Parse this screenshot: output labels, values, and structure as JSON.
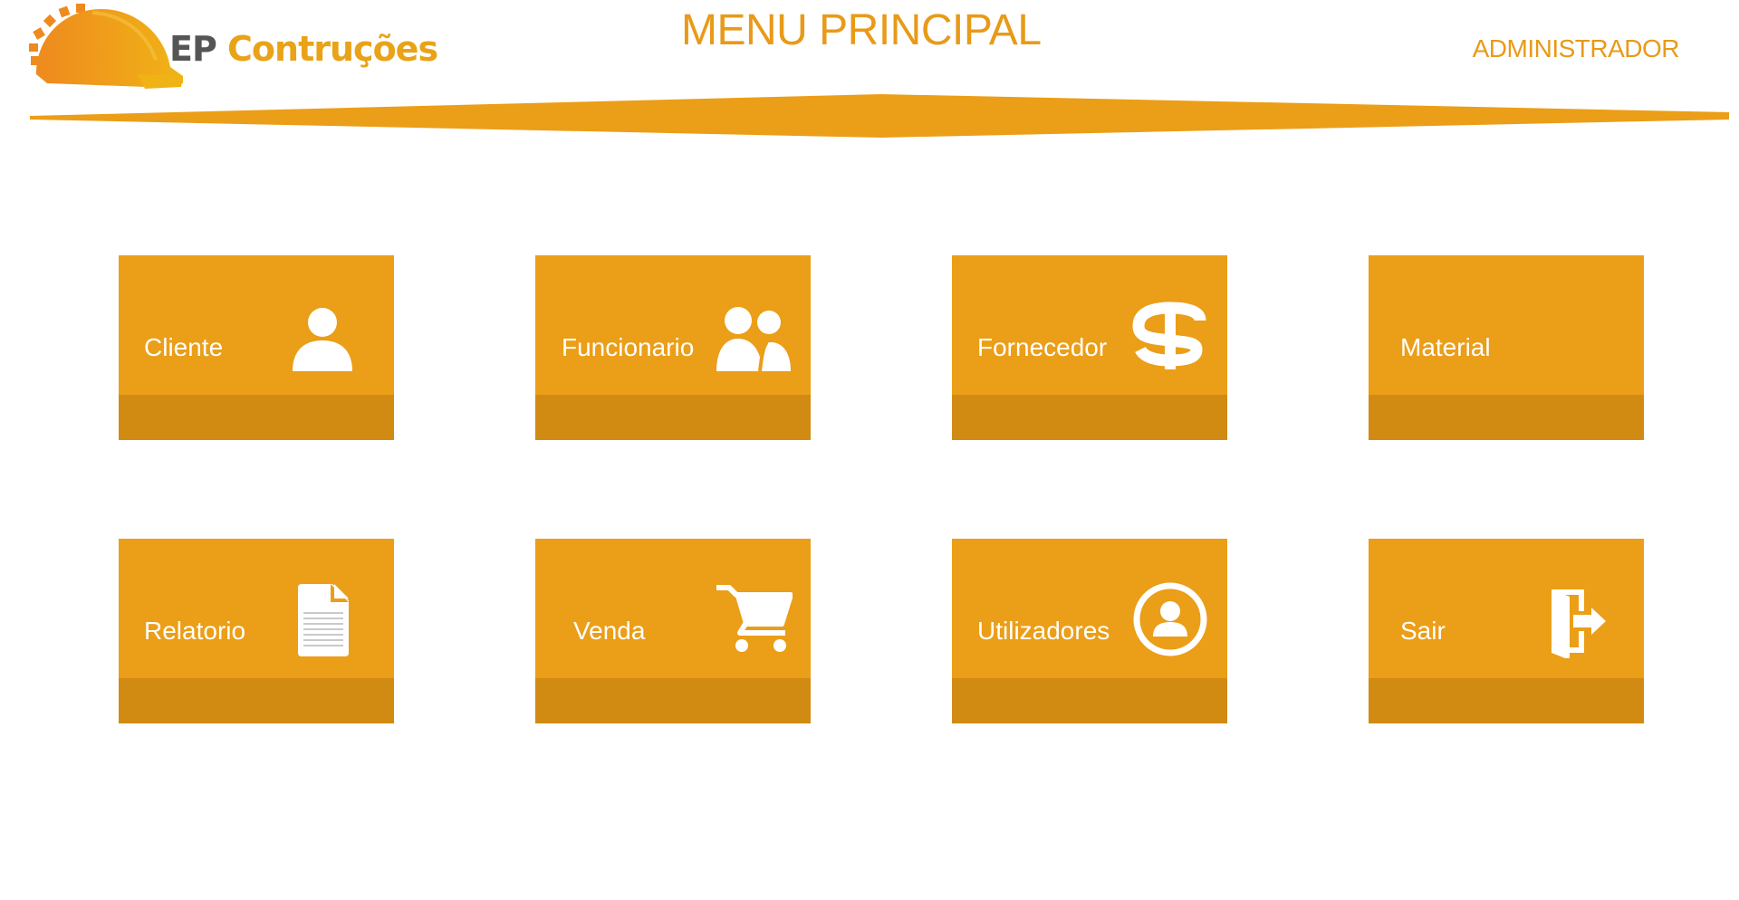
{
  "header": {
    "logo_ep": "EP",
    "logo_name": "Contruções",
    "title": "MENU PRINCIPAL",
    "user_role": "ADMINISTRADOR"
  },
  "colors": {
    "accent": "#eb9e17",
    "accent_dark": "#d18b13",
    "title": "#e89a18",
    "logo_grey": "#555555"
  },
  "menu": {
    "items": [
      {
        "label": "Cliente",
        "icon": "person-icon"
      },
      {
        "label": "Funcionario",
        "icon": "people-icon"
      },
      {
        "label": "Fornecedor",
        "icon": "dollar-icon"
      },
      {
        "label": "Material",
        "icon": ""
      },
      {
        "label": "Relatorio",
        "icon": "document-icon"
      },
      {
        "label": "Venda",
        "icon": "cart-icon"
      },
      {
        "label": "Utilizadores",
        "icon": "user-circle-icon"
      },
      {
        "label": "Sair",
        "icon": "exit-door-icon"
      }
    ]
  }
}
